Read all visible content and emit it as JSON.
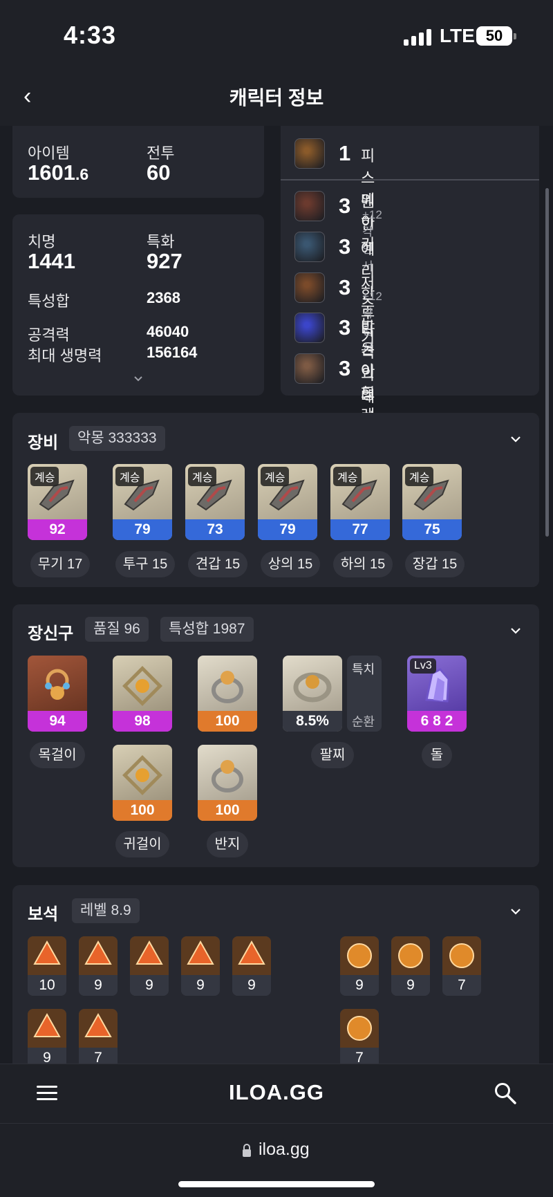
{
  "status_bar": {
    "time": "4:33",
    "network": "LTE",
    "battery": "50"
  },
  "header": {
    "title": "캐릭터 정보"
  },
  "stats": {
    "item_label": "아이템",
    "item_value": "1601",
    "item_decimal": ".6",
    "combat_label": "전투",
    "combat_value": "60",
    "crit_label": "치명",
    "crit_value": "1441",
    "spec_label": "특화",
    "spec_value": "927",
    "stat_sum_label": "특성합",
    "stat_sum_value": "2368",
    "attack_label": "공격력",
    "attack_value": "46040",
    "hp_label": "최대 생명력",
    "hp_value": "156164"
  },
  "engravings": [
    {
      "level": "1",
      "name": "피스메이커",
      "sub": "",
      "icon": "peacemaker-icon",
      "color": "#8a5a2a"
    },
    {
      "level": "3",
      "name": "원한",
      "sub": "+12 각인서",
      "icon": "grudge-icon",
      "color": "#6b3a2e"
    },
    {
      "level": "3",
      "name": "예리한 둔기",
      "sub": "",
      "icon": "keen-blunt-weapon-icon",
      "color": "#3a5670"
    },
    {
      "level": "3",
      "name": "저주받은 인형",
      "sub": "+12 각인서",
      "icon": "cursed-doll-icon",
      "color": "#7a4a2a"
    },
    {
      "level": "3",
      "name": "타격의 대가",
      "sub": "",
      "icon": "hit-master-icon",
      "color": "#3b45c9"
    },
    {
      "level": "3",
      "name": "아드레날린",
      "sub": "",
      "icon": "adrenaline-icon",
      "color": "#7d5a44"
    }
  ],
  "equipment": {
    "title": "장비",
    "chip": "악몽 333333",
    "items": [
      {
        "tag": "계승",
        "value": "92",
        "label": "무기 17",
        "icon": "gun-weapon-icon",
        "bar": "#c532d9"
      },
      {
        "tag": "계승",
        "value": "79",
        "label": "투구 15",
        "icon": "hat-icon",
        "bar": "#3569d9"
      },
      {
        "tag": "계승",
        "value": "73",
        "label": "견갑 15",
        "icon": "shoulder-armor-icon",
        "bar": "#3569d9"
      },
      {
        "tag": "계승",
        "value": "79",
        "label": "상의 15",
        "icon": "chest-armor-icon",
        "bar": "#3569d9"
      },
      {
        "tag": "계승",
        "value": "77",
        "label": "하의 15",
        "icon": "pants-armor-icon",
        "bar": "#3569d9"
      },
      {
        "tag": "계승",
        "value": "75",
        "label": "장갑 15",
        "icon": "gloves-icon",
        "bar": "#3569d9"
      }
    ]
  },
  "accessories": {
    "title": "장신구",
    "chip_quality": "품질 96",
    "chip_stats": "특성합 1987",
    "necklace": {
      "value": "94",
      "label": "목걸이",
      "icon": "necklace-icon",
      "bar": "#c532d9"
    },
    "earring1": {
      "value": "98",
      "icon": "earring-icon",
      "bar": "#c532d9"
    },
    "ring1": {
      "value": "100",
      "icon": "ring-icon",
      "bar": "#e07a2c"
    },
    "bracelet": {
      "value": "8.5%",
      "label": "팔찌",
      "side_top": "특치",
      "side_bottom": "순환",
      "icon": "bracelet-icon"
    },
    "stone": {
      "tag": "Lv3",
      "value": "6 8 2",
      "label": "돌",
      "icon": "ability-stone-icon",
      "bar": "#c532d9"
    },
    "earring2": {
      "value": "100",
      "label": "귀걸이",
      "icon": "earring-icon",
      "bar": "#e07a2c"
    },
    "ring2": {
      "value": "100",
      "label": "반지",
      "icon": "ring-icon",
      "bar": "#e07a2c"
    }
  },
  "gems": {
    "title": "보석",
    "chip": "레벨 8.9",
    "damage_gems": [
      "10",
      "9",
      "9",
      "9",
      "9",
      "9",
      "7"
    ],
    "cooldown_gems": [
      "9",
      "9",
      "7",
      "7"
    ]
  },
  "bottom_nav": {
    "logo": "ILOA.GG"
  },
  "url_bar": {
    "url": "iloa.gg"
  }
}
